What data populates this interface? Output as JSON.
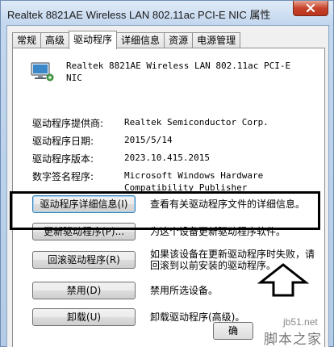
{
  "window": {
    "title": "Realtek 8821AE Wireless LAN 802.11ac PCI-E NIC 属性"
  },
  "tabs": [
    {
      "label": "常规"
    },
    {
      "label": "高级"
    },
    {
      "label": "驱动程序"
    },
    {
      "label": "详细信息"
    },
    {
      "label": "资源"
    },
    {
      "label": "电源管理"
    }
  ],
  "device": {
    "name": "Realtek 8821AE Wireless LAN 802.11ac PCI-E NIC",
    "icon": "network-adapter-icon"
  },
  "properties": [
    {
      "label": "驱动程序提供商:",
      "value": "Realtek Semiconductor Corp."
    },
    {
      "label": "驱动程序日期:",
      "value": "2015/5/14"
    },
    {
      "label": "驱动程序版本:",
      "value": "2023.10.415.2015"
    },
    {
      "label": "数字签名程序:",
      "value": "Microsoft Windows Hardware Compatibility Publisher"
    }
  ],
  "actions": [
    {
      "button": "驱动程序详细信息(I)",
      "description": "查看有关驱动程序文件的详细信息。"
    },
    {
      "button": "更新驱动程序(P)...",
      "description": "为这个设备更新驱动程序软件。"
    },
    {
      "button": "回滚驱动程序(R)",
      "description": "如果该设备在更新驱动程序时失败，请回滚到以前安装的驱动程序。"
    },
    {
      "button": "禁用(D)",
      "description": "禁用所选设备。"
    },
    {
      "button": "卸载(U)",
      "description": "卸载驱动程序(高级)。"
    }
  ],
  "footer": {
    "ok_partial": "确"
  },
  "watermark": {
    "url": "jb51.net",
    "name": "脚本之家"
  },
  "colors": {
    "highlight_box": "#000000",
    "close_button": "#c7432b"
  }
}
